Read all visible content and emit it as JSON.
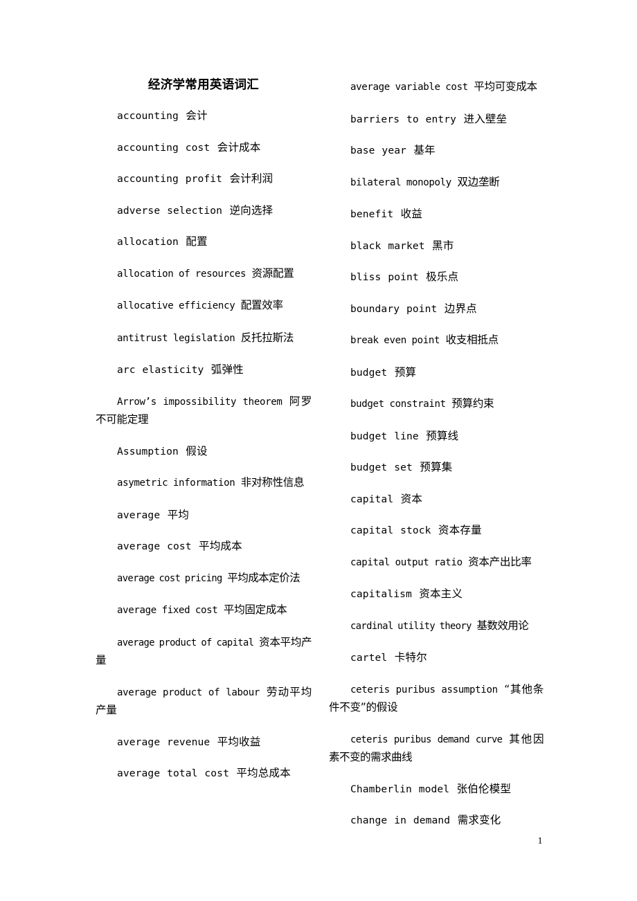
{
  "document": {
    "title": "经济学常用英语词汇",
    "page_number": "1",
    "background_color": "#ffffff",
    "text_color": "#000000"
  },
  "columns": {
    "left": {
      "entries": [
        {
          "en": "accounting",
          "zh": "会计"
        },
        {
          "en": "accounting cost",
          "zh": "会计成本"
        },
        {
          "en": "accounting profit",
          "zh": "会计利润"
        },
        {
          "en": "adverse selection",
          "zh": "逆向选择"
        },
        {
          "en": "allocation",
          "zh": "配置"
        },
        {
          "en": "allocation of resources",
          "zh": "资源配置"
        },
        {
          "en": "allocative efficiency",
          "zh": "配置效率"
        },
        {
          "en": "antitrust legislation",
          "zh": "反托拉斯法"
        },
        {
          "en": "arc elasticity",
          "zh": "弧弹性"
        },
        {
          "en": "Arrow’s impossibility theorem",
          "zh": "阿罗不可能定理"
        },
        {
          "en": "Assumption",
          "zh": "假设"
        },
        {
          "en": "asymetric information",
          "zh": "非对称性信息"
        },
        {
          "en": "average",
          "zh": "平均"
        },
        {
          "en": "average cost",
          "zh": "平均成本"
        },
        {
          "en": "average cost pricing",
          "zh": "平均成本定价法"
        },
        {
          "en": "average fixed cost",
          "zh": "平均固定成本"
        },
        {
          "en": "average product of capital",
          "zh": "资本平均产量"
        },
        {
          "en": "average product of labour",
          "zh": "劳动平均产量"
        },
        {
          "en": "average revenue",
          "zh": "平均收益"
        },
        {
          "en": "average total cost",
          "zh": "平均总成本"
        }
      ]
    },
    "right": {
      "entries": [
        {
          "en": "average variable cost",
          "zh": "平均可变成本"
        },
        {
          "en": "barriers to entry",
          "zh": "进入壁垒"
        },
        {
          "en": "base year",
          "zh": "基年"
        },
        {
          "en": "bilateral monopoly",
          "zh": "双边垄断"
        },
        {
          "en": "benefit",
          "zh": "收益"
        },
        {
          "en": "black market",
          "zh": "黑市"
        },
        {
          "en": "bliss point",
          "zh": "极乐点"
        },
        {
          "en": "boundary point",
          "zh": "边界点"
        },
        {
          "en": "break even point",
          "zh": "收支相抵点"
        },
        {
          "en": "budget",
          "zh": "预算"
        },
        {
          "en": "budget constraint",
          "zh": "预算约束"
        },
        {
          "en": "budget line",
          "zh": "预算线"
        },
        {
          "en": "budget set",
          "zh": "预算集"
        },
        {
          "en": "capital",
          "zh": "资本"
        },
        {
          "en": "capital stock",
          "zh": "资本存量"
        },
        {
          "en": "capital output ratio",
          "zh": "资本产出比率"
        },
        {
          "en": "capitalism",
          "zh": "资本主义"
        },
        {
          "en": "cardinal utility theory",
          "zh": "基数效用论"
        },
        {
          "en": "cartel",
          "zh": "卡特尔"
        },
        {
          "en": "ceteris puribus assumption",
          "zh": "“其他条件不变”的假设"
        },
        {
          "en": "ceteris puribus demand curve",
          "zh": "其他因素不变的需求曲线"
        },
        {
          "en": "Chamberlin model",
          "zh": "张伯伦模型"
        },
        {
          "en": "change in demand",
          "zh": "需求变化"
        }
      ]
    }
  }
}
